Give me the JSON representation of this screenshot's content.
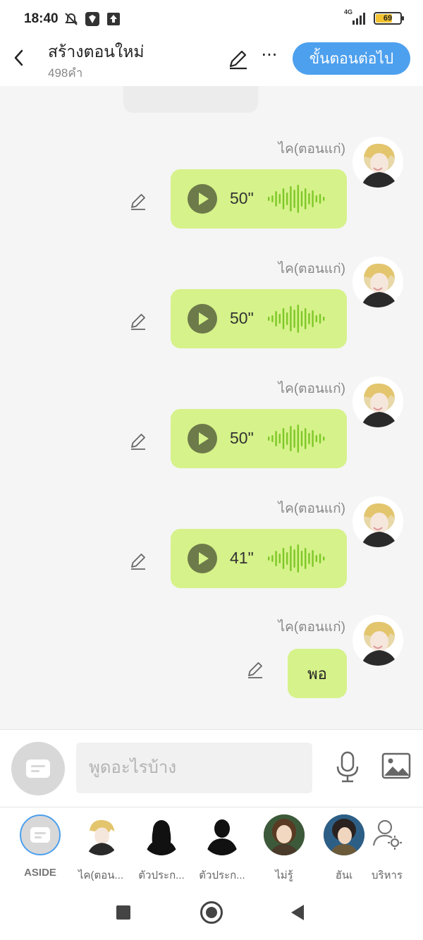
{
  "status_bar": {
    "time": "18:40",
    "network": "4G",
    "battery": "69",
    "battery_level": 0.69,
    "icons": [
      "alarm-off-icon",
      "app-notification-icon",
      "upload-icon",
      "signal-icon",
      "battery-icon"
    ]
  },
  "header": {
    "title": "สร้างตอนใหม่",
    "word_count": "498คำ",
    "next_button": "ขั้นตอนต่อไป",
    "more_label": "···"
  },
  "messages": [
    {
      "speaker": "ไค(ตอนแก่)",
      "type": "voice",
      "duration": "50\""
    },
    {
      "speaker": "ไค(ตอนแก่)",
      "type": "voice",
      "duration": "50\""
    },
    {
      "speaker": "ไค(ตอนแก่)",
      "type": "voice",
      "duration": "50\""
    },
    {
      "speaker": "ไค(ตอนแก่)",
      "type": "voice",
      "duration": "41\""
    },
    {
      "speaker": "ไค(ตอนแก่)",
      "type": "text",
      "text": "พอ"
    }
  ],
  "input": {
    "placeholder": "พูดอะไรบ้าง"
  },
  "characters": [
    {
      "label": "ASIDE"
    },
    {
      "label": "ไค(ตอน..."
    },
    {
      "label": "ตัวประก..."
    },
    {
      "label": "ตัวประก..."
    },
    {
      "label": "ไม่รู้"
    },
    {
      "label": "ฮันเ"
    },
    {
      "label": "บริหาร"
    }
  ],
  "colors": {
    "accent": "#4da0ee",
    "bubble": "#d6f28a",
    "play": "#6d7a4a",
    "wave": "#7ec828"
  }
}
